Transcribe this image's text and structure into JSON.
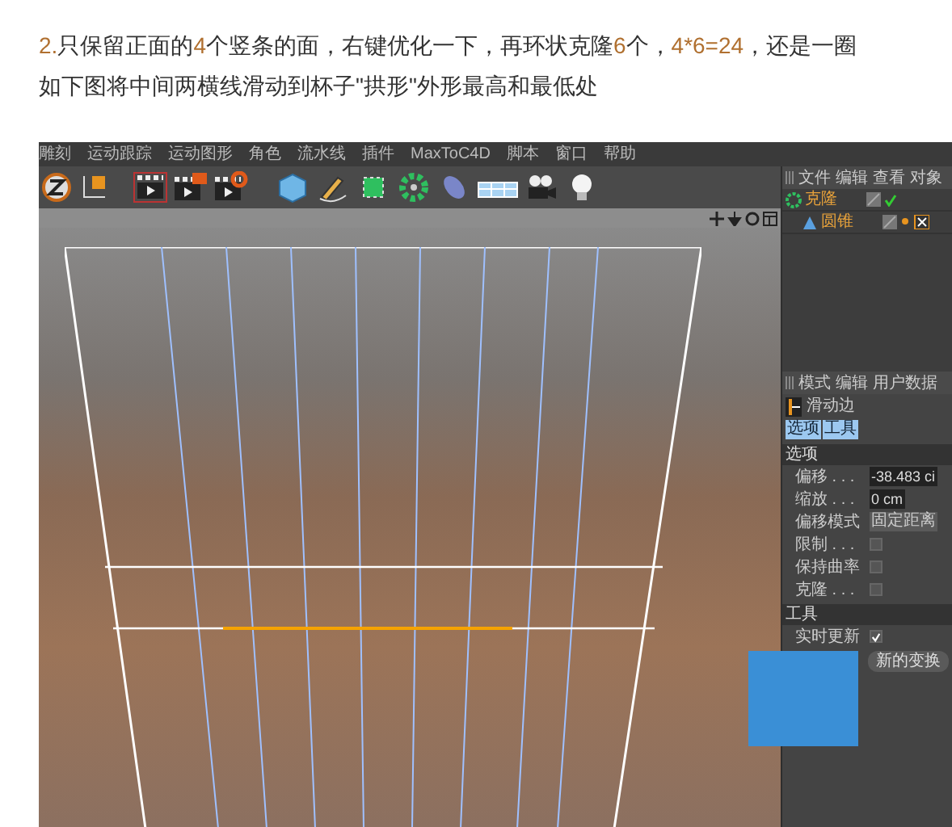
{
  "article": {
    "lines": [
      [
        {
          "text": "2.",
          "highlight": true
        },
        {
          "text": "只保留正面的",
          "highlight": false
        },
        {
          "text": "4",
          "highlight": true
        },
        {
          "text": "个竖条的面，右键优化一下，再环状克隆",
          "highlight": false
        },
        {
          "text": "6",
          "highlight": true
        },
        {
          "text": "个，",
          "highlight": false
        },
        {
          "text": "4*6=24",
          "highlight": true
        },
        {
          "text": "，还是一圈",
          "highlight": false
        }
      ],
      [
        {
          "text": "如下图将中间两横线滑动到杯子\"拱形\"外形最高和最低处",
          "highlight": false
        }
      ]
    ]
  },
  "app": {
    "menu": [
      "雕刻",
      "运动跟踪",
      "运动图形",
      "角色",
      "流水线",
      "插件",
      "MaxToC4D",
      "脚本",
      "窗口",
      "帮助"
    ],
    "object_manager": {
      "menu": [
        "文件",
        "编辑",
        "查看",
        "对象"
      ],
      "objects": [
        {
          "name": "克隆",
          "selected": true,
          "children": [
            {
              "name": "圆锥",
              "selected": true
            }
          ]
        }
      ]
    },
    "attribute_manager": {
      "menu": [
        "模式",
        "编辑",
        "用户数据"
      ],
      "tool": "滑动边",
      "tabs": [
        {
          "label": "选项",
          "selected": true
        },
        {
          "label": "工具",
          "selected": true
        }
      ],
      "sections": [
        {
          "title": "选项",
          "rows": [
            {
              "kind": "number",
              "label": "偏移 . . .",
              "value": "-38.483 ci"
            },
            {
              "kind": "number",
              "label": "缩放 . . .",
              "value": "0 cm"
            },
            {
              "kind": "dropdown",
              "label": "偏移模式",
              "value": "固定距离"
            },
            {
              "kind": "checkbox",
              "label": "限制 . . .",
              "checked": false
            },
            {
              "kind": "checkbox",
              "label": "保持曲率",
              "checked": false
            },
            {
              "kind": "checkbox",
              "label": "克隆 . . .",
              "checked": false
            }
          ]
        },
        {
          "title": "工具",
          "rows": [
            {
              "kind": "checkbox",
              "label": "实时更新",
              "checked": true
            },
            {
              "kind": "button",
              "label": "新的变换"
            }
          ]
        }
      ]
    }
  }
}
